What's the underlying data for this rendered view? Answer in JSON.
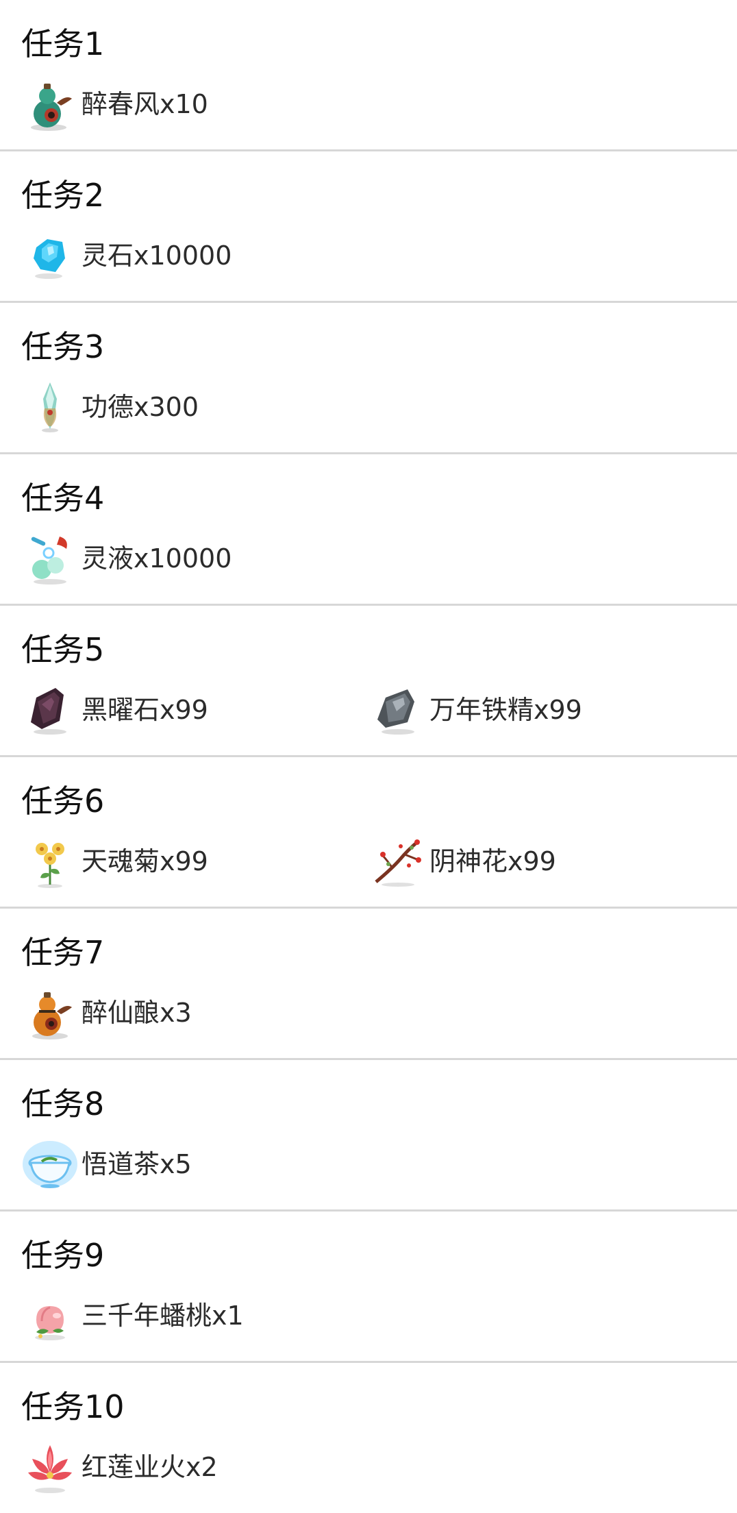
{
  "tasks": [
    {
      "title": "任务1",
      "rewards": [
        {
          "icon": "gourd-wine-green-icon",
          "text": "醉春风x10"
        }
      ]
    },
    {
      "title": "任务2",
      "rewards": [
        {
          "icon": "spirit-stone-icon",
          "text": "灵石x10000"
        }
      ]
    },
    {
      "title": "任务3",
      "rewards": [
        {
          "icon": "merit-crystal-icon",
          "text": "功德x300"
        }
      ]
    },
    {
      "title": "任务4",
      "rewards": [
        {
          "icon": "spirit-liquid-icon",
          "text": "灵液x10000"
        }
      ]
    },
    {
      "title": "任务5",
      "rewards": [
        {
          "icon": "obsidian-icon",
          "text": "黑曜石x99"
        },
        {
          "icon": "iron-essence-icon",
          "text": "万年铁精x99"
        }
      ]
    },
    {
      "title": "任务6",
      "rewards": [
        {
          "icon": "chrysanthemum-icon",
          "text": "天魂菊x99"
        },
        {
          "icon": "yin-flower-branch-icon",
          "text": "阴神花x99"
        }
      ]
    },
    {
      "title": "任务7",
      "rewards": [
        {
          "icon": "gourd-wine-orange-icon",
          "text": "醉仙酿x3"
        }
      ]
    },
    {
      "title": "任务8",
      "rewards": [
        {
          "icon": "tea-bowl-icon",
          "text": "悟道茶x5"
        }
      ]
    },
    {
      "title": "任务9",
      "rewards": [
        {
          "icon": "peach-icon",
          "text": "三千年蟠桃x1"
        }
      ]
    },
    {
      "title": "任务10",
      "rewards": [
        {
          "icon": "red-lotus-icon",
          "text": "红莲业火x2"
        }
      ]
    }
  ],
  "colors": {
    "divider": "#d7d7d7",
    "title": "#111111",
    "reward_text": "#2b2b2b"
  }
}
